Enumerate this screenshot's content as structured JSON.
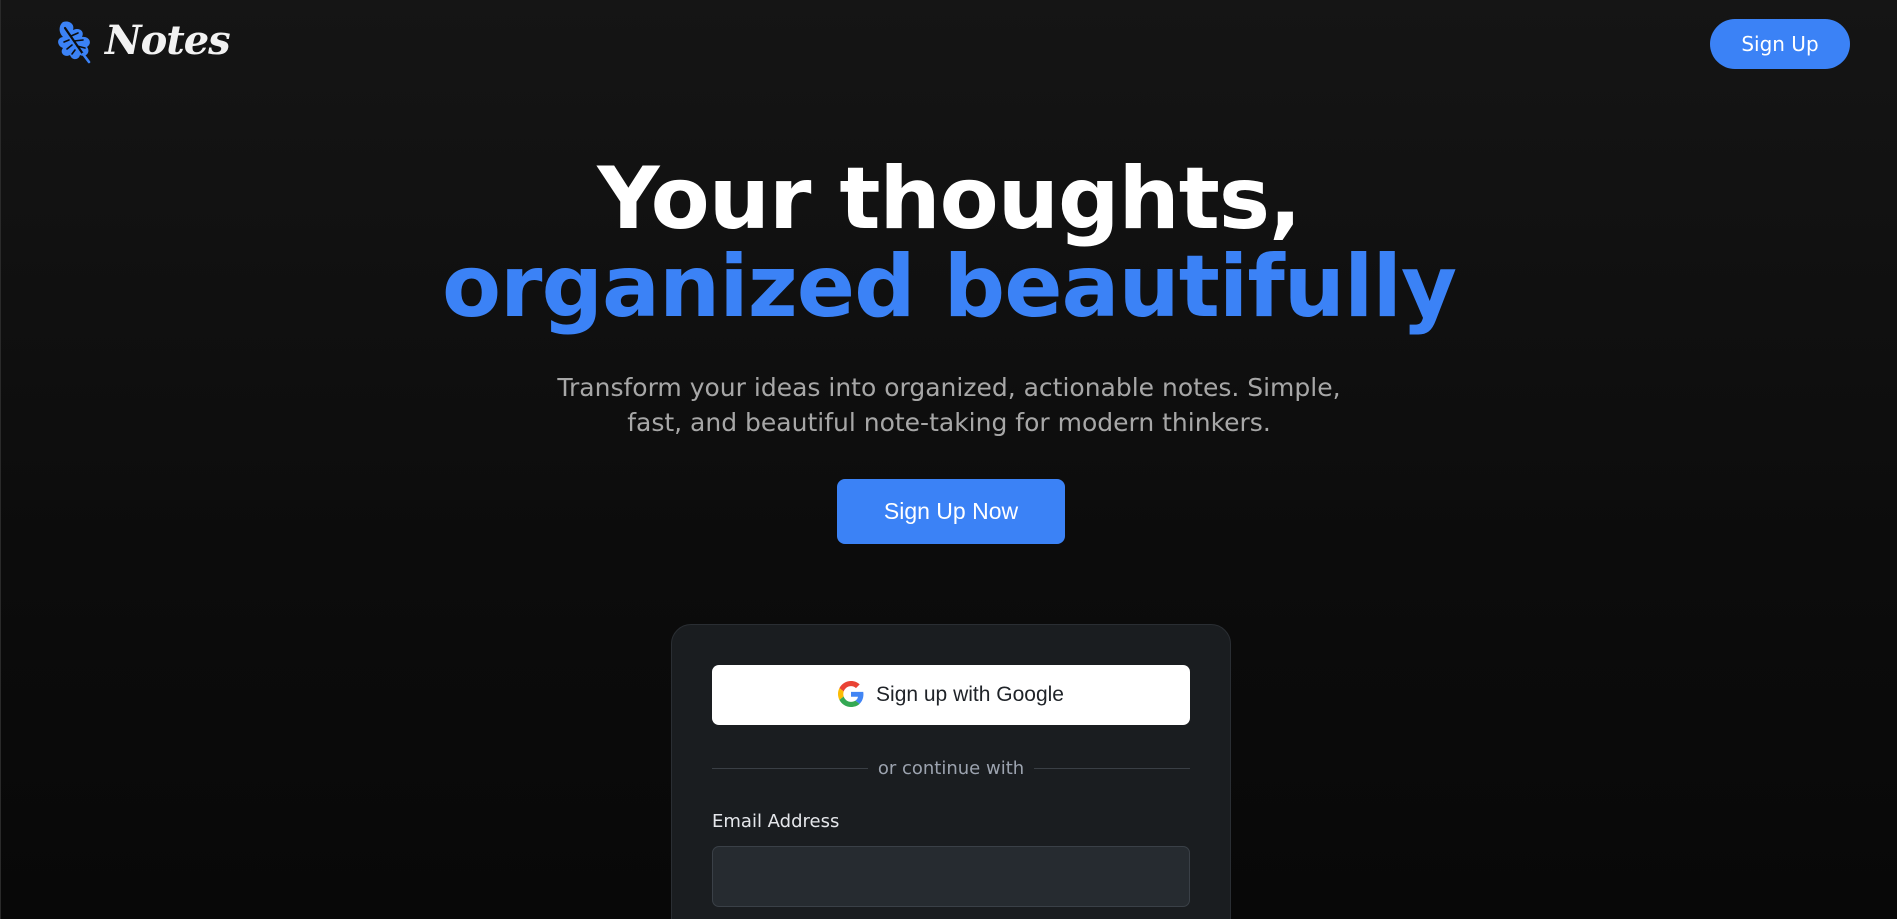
{
  "header": {
    "brand_name": "Notes",
    "brand_icon": "leaf-icon",
    "signup_label": "Sign Up"
  },
  "hero": {
    "line1": "Your thoughts,",
    "line2": "organized beautifully",
    "subtitle_line1": "Transform your ideas into organized, actionable notes. Simple,",
    "subtitle_line2": "fast, and beautiful note-taking for modern thinkers.",
    "cta_label": "Sign Up Now"
  },
  "signup_card": {
    "google_label": "Sign up with Google",
    "google_icon": "google-icon",
    "divider_text": "or continue with",
    "email_label": "Email Address",
    "email_value": "",
    "email_placeholder": ""
  },
  "colors": {
    "accent": "#3b82f6",
    "background": "#0c0c0c",
    "card": "#1a1d20"
  }
}
